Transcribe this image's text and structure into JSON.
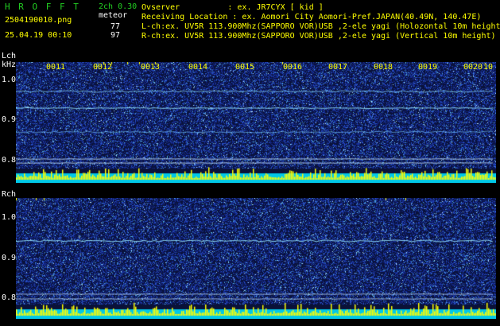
{
  "header": {
    "title": "H R O F F T",
    "mode": "2ch 0.30",
    "filename": "2504190010.png",
    "meteor_label": "meteor",
    "datetime": "25.04.19 00:10",
    "count_l": "77",
    "count_r": "97",
    "observer": "Ovserver          : ex. JR7CYX [ kid ]",
    "location": "Receiving Location : ex. Aomori City Aomori-Pref.JAPAN(40.49N, 140.47E)",
    "lch_info": "L-ch:ex. UV5R 113.900Mhz(SAPPORO VOR)USB ,2-ele yagi (Holozontal 10m height",
    "rch_info": "R-ch:ex. UV5R 113.900Mhz(SAPPORO VOR)USB ,2-ele yagi (Vertical 10m height)"
  },
  "colors": {
    "title": "#22cc22",
    "text": "#ffffff",
    "label": "#ffff00",
    "count": "#ffffff",
    "bg": "#000000",
    "noise_blue": "#1a2a9a",
    "signal": "#00ffff",
    "bars": "#ffff00"
  },
  "lch": {
    "label": "Lch",
    "unit": "kHz",
    "y_ticks": [
      "1.0",
      "0.9",
      "0.8"
    ],
    "time_labels": [
      "0011",
      "0012",
      "0013",
      "0014",
      "0015",
      "0016",
      "0017",
      "0018",
      "0019",
      "0020"
    ],
    "end_label": "10"
  },
  "rch": {
    "label": "Rch",
    "y_ticks": [
      "1.0",
      "0.9",
      "0.8"
    ]
  }
}
